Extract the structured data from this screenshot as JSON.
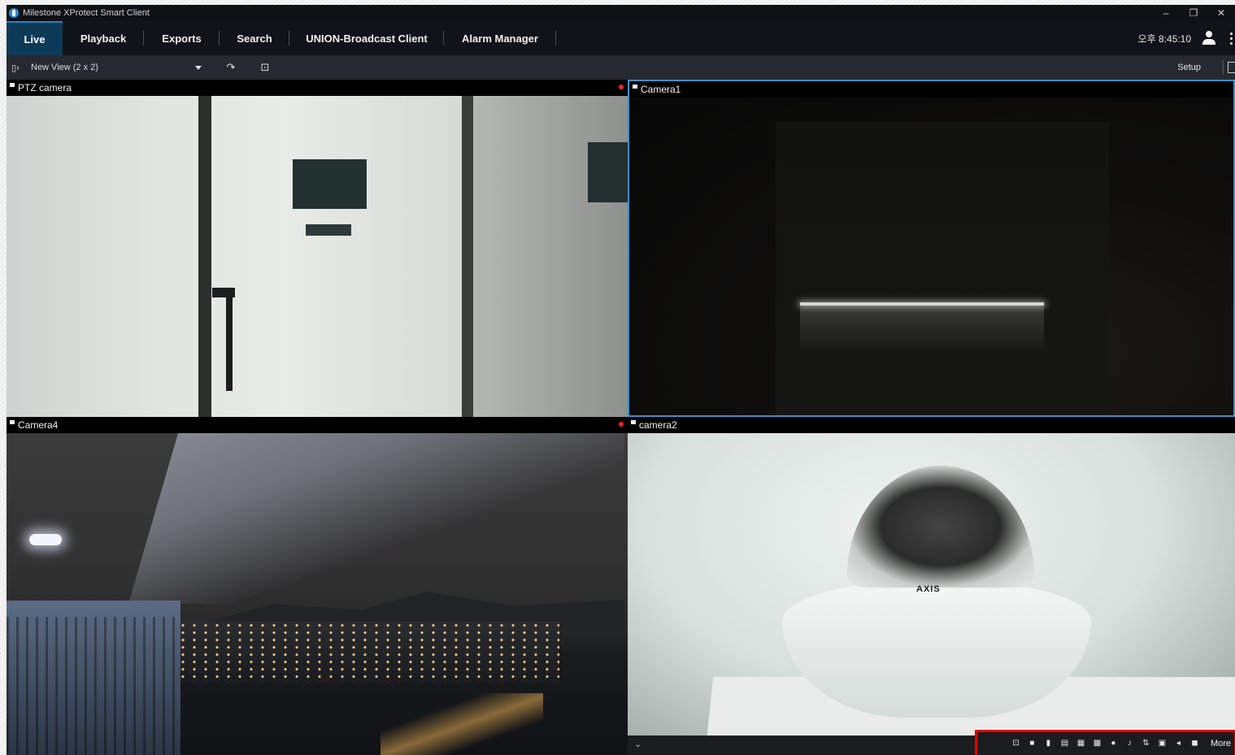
{
  "window": {
    "title": "Milestone XProtect Smart Client",
    "minimize": "–",
    "restore": "❐",
    "close": "✕"
  },
  "nav": {
    "tabs": [
      {
        "label": "Live"
      },
      {
        "label": "Playback"
      },
      {
        "label": "Exports"
      },
      {
        "label": "Search"
      },
      {
        "label": "UNION-Broadcast Client"
      },
      {
        "label": "Alarm Manager"
      }
    ],
    "clock": "오후 8:45:10"
  },
  "toolbar": {
    "view_name": "New View (2 x 2)",
    "setup_label": "Setup"
  },
  "cameras": [
    {
      "name": "PTZ camera",
      "recording": true
    },
    {
      "name": "Camera1",
      "recording": false,
      "selected": true
    },
    {
      "name": "Camera4",
      "recording": true
    },
    {
      "name": "camera2",
      "recording": false
    }
  ],
  "camera2": {
    "brand": "AXIS"
  },
  "camera_toolbar": {
    "icons": [
      "magnify-icon",
      "video-icon",
      "bookmark-icon",
      "save-icon",
      "print-icon",
      "clipboard-icon",
      "record-icon",
      "microphone-icon",
      "talk-icon",
      "snapshot-icon",
      "speaker-icon",
      "stop-icon"
    ],
    "more_label": "More"
  },
  "colors": {
    "accent": "#1f86c8",
    "active_tab": "#0f3a57",
    "recording": "#ff2020",
    "highlight": "#e00000"
  }
}
